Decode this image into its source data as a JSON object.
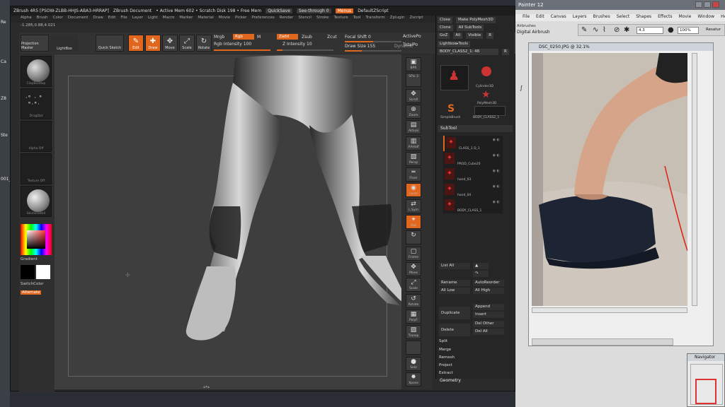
{
  "desktop": {
    "icons": [
      "Re",
      "Ca",
      "Z8",
      "Ste",
      "001_"
    ]
  },
  "zbrush": {
    "title": "ZBrush 4R5 [PSOW-ZLBB-HHJS-ABA3-HRRAP]",
    "doc": "ZBrush Document",
    "mem": "• Active Mem 602 • Scratch Disk 198 • Free Mem",
    "quicksave": "QuickSave",
    "seethrough": "See-through",
    "seethrough_val": "0",
    "menus_btn": "Menus",
    "script": "DefaultZScript",
    "menu": [
      "Alpha",
      "Brush",
      "Color",
      "Document",
      "Draw",
      "Edit",
      "File",
      "Layer",
      "Light",
      "Macro",
      "Marker",
      "Material",
      "Movie",
      "Picker",
      "Preferences",
      "Render",
      "Stencil",
      "Stroke",
      "Texture",
      "Tool",
      "Transform",
      "Zplugin",
      "Zscript"
    ],
    "coords": "-1.285,0.88,4.021",
    "projection_master": "Projection Master",
    "lightbox": "LightBox",
    "quick_sketch": "Quick Sketch",
    "tools": {
      "edit": "Edit",
      "draw": "Draw",
      "move": "Move",
      "scale": "Scale",
      "rotate": "Rotate"
    },
    "mrgb": "Mrgb",
    "rgb": "Rgb",
    "m": "M",
    "rgb_intensity": "Rgb Intensity 100",
    "zadd": "Zadd",
    "zsub": "Zsub",
    "zcut": "Zcut",
    "z_intensity": "Z Intensity 10",
    "focal_shift": "Focal Shift 0",
    "draw_size": "Draw Size 155",
    "dynamic": "Dynamic",
    "active_points": "ActivePo",
    "total_points": "TotalPo",
    "left_shelf": {
      "brush": "ClayBuildup",
      "stroke": "DragDot",
      "alpha": "Alpha Off",
      "texture": "Texture Off",
      "material": "SkinShade4",
      "gradient": "Gradient",
      "switch": "SwitchColor",
      "alternate": "Alternate"
    },
    "right_shelf": [
      {
        "label": "BPR",
        "icon": "▣"
      },
      {
        "label": "SPix 3",
        "icon": ""
      },
      {
        "label": "Scroll",
        "icon": "✥"
      },
      {
        "label": "Zoom",
        "icon": "⊕"
      },
      {
        "label": "Actual",
        "icon": "▤"
      },
      {
        "label": "AAHalf",
        "icon": "▥"
      },
      {
        "label": "Persp",
        "icon": "▧"
      },
      {
        "label": "Floor",
        "icon": "═"
      },
      {
        "label": "Local",
        "icon": "◉"
      },
      {
        "label": "L.Sym",
        "icon": "⇄"
      },
      {
        "label": "Xyz",
        "icon": "✦"
      },
      {
        "label": "",
        "icon": "↻"
      },
      {
        "label": "Frame",
        "icon": "▢"
      },
      {
        "label": "Move",
        "icon": "✥"
      },
      {
        "label": "Scale",
        "icon": "⤢"
      },
      {
        "label": "Rotate",
        "icon": "↺"
      },
      {
        "label": "PolyF",
        "icon": "▦"
      },
      {
        "label": "Transp",
        "icon": "▨"
      },
      {
        "label": "",
        "icon": ""
      },
      {
        "label": "Solo",
        "icon": "●"
      },
      {
        "label": "Xpose",
        "icon": "✸"
      }
    ],
    "tool": {
      "close": "Close",
      "make": "Make PolyMesh3D",
      "clone": "Clone",
      "clone_all": "All SubTools",
      "goz": "GoZ",
      "all": "All",
      "visible": "Visible",
      "r": "R",
      "lightbox_tools": "Lightbox▸Tools",
      "current": "BODY_CLASS2_1: 48",
      "thumbs": [
        "",
        "Cylinder3D",
        "",
        "PolyMesh3D",
        "SimpleBrush",
        "BODY_CLASS2_1"
      ],
      "subtool": "SubTool",
      "subtools": [
        "CLASS_1 D_1",
        "PROD_Cube20",
        "hand_03",
        "hand_04",
        "BODY_CLASS_1"
      ],
      "list_all": "List All",
      "rename": "Rename",
      "autoreorder": "AutoReorder",
      "all_low": "All Low",
      "all_high": "All High",
      "duplicate": "Duplicate",
      "append": "Append",
      "insert": "Insert",
      "delete": "Delete",
      "del_other": "Del Other",
      "del_all": "Del All",
      "split": "Split",
      "merge": "Merge",
      "remesh": "Remesh",
      "project": "Project",
      "extract": "Extract",
      "geometry": "Geometry"
    }
  },
  "painter": {
    "title": "Painter 12",
    "menu": [
      "File",
      "Edit",
      "Canvas",
      "Layers",
      "Brushes",
      "Select",
      "Shapes",
      "Effects",
      "Movie",
      "Window",
      "Help"
    ],
    "brush_cat": "Airbrushes",
    "brush_var": "Digital Airbrush",
    "size": "4.3",
    "opacity": "100%",
    "resat": "Resatur",
    "doc_title": "DSC_0250.JPG @ 32.1%",
    "navigator": "Navigator"
  },
  "colors": {
    "accent": "#e2671e",
    "panel": "#2b2b2b"
  }
}
